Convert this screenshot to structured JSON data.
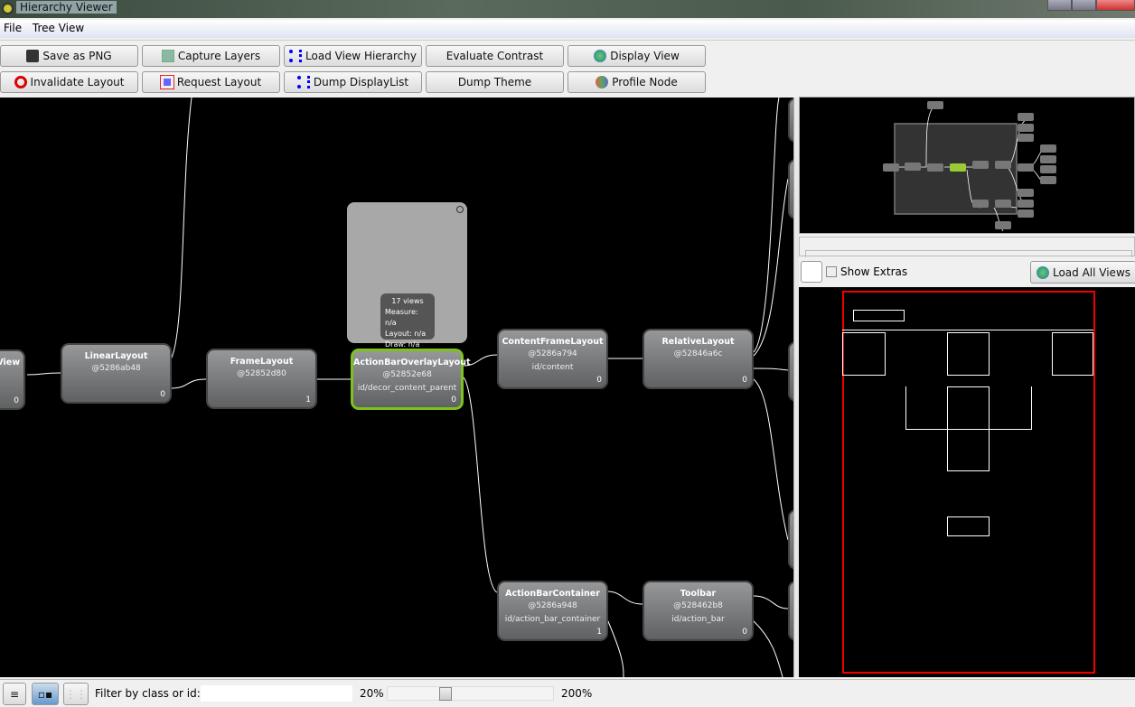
{
  "window": {
    "title": "Hierarchy Viewer"
  },
  "menu": [
    "File",
    "Tree View"
  ],
  "toolbar": {
    "row1": [
      {
        "label": "Save as PNG",
        "icon": "floppy-icon"
      },
      {
        "label": "Capture Layers",
        "icon": "layers-icon"
      },
      {
        "label": "Load View Hierarchy",
        "icon": "hierarchy-icon"
      },
      {
        "label": "Evaluate Contrast",
        "icon": ""
      },
      {
        "label": "Display View",
        "icon": "globe-icon"
      }
    ],
    "row2": [
      {
        "label": "Invalidate Layout",
        "icon": "no-entry-icon"
      },
      {
        "label": "Request Layout",
        "icon": "request-layout-icon"
      },
      {
        "label": "Dump DisplayList",
        "icon": "hierarchy-icon"
      },
      {
        "label": "Dump Theme",
        "icon": ""
      },
      {
        "label": "Profile Node",
        "icon": "profile-icon"
      }
    ]
  },
  "tree": {
    "nodes": [
      {
        "name": "View",
        "addr": "",
        "id": "",
        "count": "0"
      },
      {
        "name": "LinearLayout",
        "addr": "@5286ab48",
        "id": "",
        "count": "0"
      },
      {
        "name": "FrameLayout",
        "addr": "@52852d80",
        "id": "",
        "count": "1"
      },
      {
        "name": "ActionBarOverlayLayout",
        "addr": "@52852e68",
        "id": "id/decor_content_parent",
        "count": "0",
        "selected": true
      },
      {
        "name": "ContentFrameLayout",
        "addr": "@5286a794",
        "id": "id/content",
        "count": "0"
      },
      {
        "name": "RelativeLayout",
        "addr": "@52846a6c",
        "id": "",
        "count": "0"
      },
      {
        "name": "ActionBarContainer",
        "addr": "@5286a948",
        "id": "id/action_bar_container",
        "count": "1"
      },
      {
        "name": "Toolbar",
        "addr": "@528462b8",
        "id": "id/action_bar",
        "count": "0"
      }
    ],
    "tooltip": {
      "views": "17 views",
      "measure": "Measure: n/a",
      "layout": "Layout: n/a",
      "draw": "Draw: n/a"
    },
    "selected_color": "#7ec21c"
  },
  "right": {
    "show_extras": "Show Extras",
    "show_extras_checked": false,
    "load_all": "Load All Views"
  },
  "status": {
    "filter_label": "Filter by class or id:",
    "filter_value": "",
    "zoom_min": "20%",
    "zoom_max": "200%",
    "zoom_percent": 25
  }
}
